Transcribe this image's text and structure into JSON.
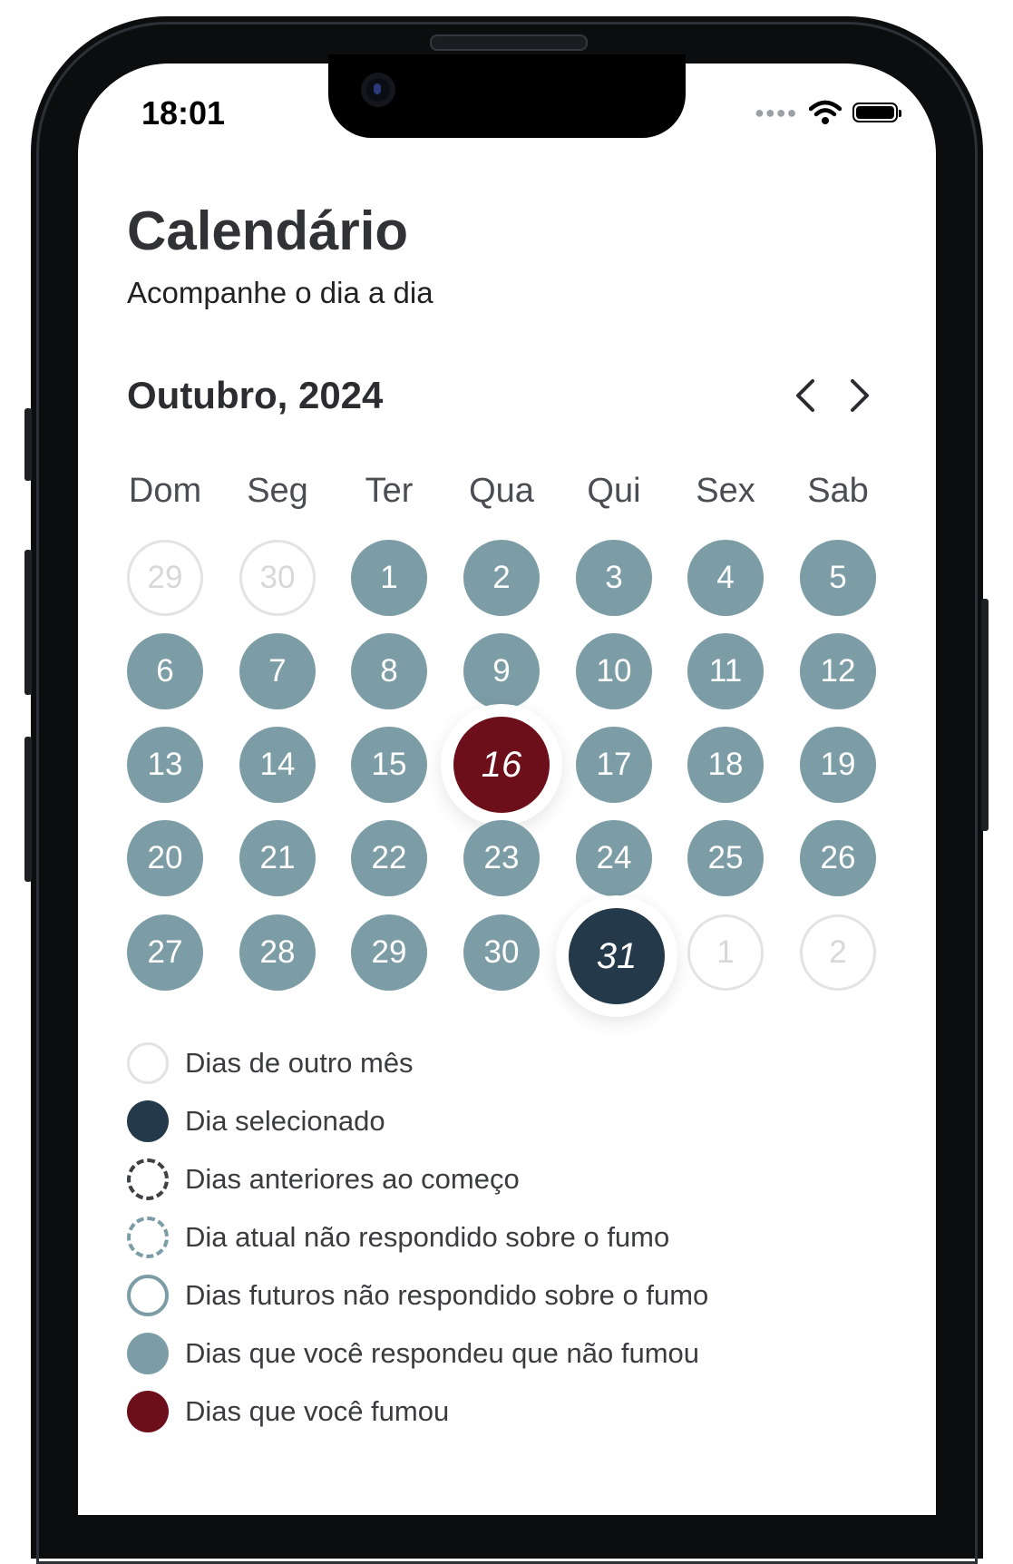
{
  "status_bar": {
    "time": "18:01"
  },
  "header": {
    "title": "Calendário",
    "subtitle": "Acompanhe o dia a dia"
  },
  "calendar": {
    "month_label": "Outubro, 2024",
    "weekdays": [
      "Dom",
      "Seg",
      "Ter",
      "Qua",
      "Qui",
      "Sex",
      "Sab"
    ],
    "weeks": [
      [
        {
          "n": "29",
          "s": "other"
        },
        {
          "n": "30",
          "s": "other"
        },
        {
          "n": "1",
          "s": "done"
        },
        {
          "n": "2",
          "s": "done"
        },
        {
          "n": "3",
          "s": "done"
        },
        {
          "n": "4",
          "s": "done"
        },
        {
          "n": "5",
          "s": "done"
        }
      ],
      [
        {
          "n": "6",
          "s": "done"
        },
        {
          "n": "7",
          "s": "done"
        },
        {
          "n": "8",
          "s": "done"
        },
        {
          "n": "9",
          "s": "done"
        },
        {
          "n": "10",
          "s": "done"
        },
        {
          "n": "11",
          "s": "done"
        },
        {
          "n": "12",
          "s": "done"
        }
      ],
      [
        {
          "n": "13",
          "s": "done"
        },
        {
          "n": "14",
          "s": "done"
        },
        {
          "n": "15",
          "s": "done"
        },
        {
          "n": "16",
          "s": "smoked"
        },
        {
          "n": "17",
          "s": "done"
        },
        {
          "n": "18",
          "s": "done"
        },
        {
          "n": "19",
          "s": "done"
        }
      ],
      [
        {
          "n": "20",
          "s": "done"
        },
        {
          "n": "21",
          "s": "done"
        },
        {
          "n": "22",
          "s": "done"
        },
        {
          "n": "23",
          "s": "done"
        },
        {
          "n": "24",
          "s": "done"
        },
        {
          "n": "25",
          "s": "done"
        },
        {
          "n": "26",
          "s": "done"
        }
      ],
      [
        {
          "n": "27",
          "s": "done"
        },
        {
          "n": "28",
          "s": "done"
        },
        {
          "n": "29",
          "s": "done"
        },
        {
          "n": "30",
          "s": "done"
        },
        {
          "n": "31",
          "s": "selected"
        },
        {
          "n": "1",
          "s": "other"
        },
        {
          "n": "2",
          "s": "other"
        }
      ]
    ]
  },
  "legend": [
    {
      "key": "other",
      "label": "Dias de outro mês"
    },
    {
      "key": "selected",
      "label": "Dia selecionado"
    },
    {
      "key": "before",
      "label": "Dias anteriores ao começo"
    },
    {
      "key": "today",
      "label": "Dia atual não respondido sobre o fumo"
    },
    {
      "key": "future",
      "label": "Dias futuros não respondido sobre o fumo"
    },
    {
      "key": "done",
      "label": "Dias que você respondeu que não fumou"
    },
    {
      "key": "smoked",
      "label": "Dias que você fumou"
    }
  ],
  "colors": {
    "answered_no_smoke": "#7d9da6",
    "smoked": "#6c0f1a",
    "selected": "#243a4b",
    "other_month_border": "#e3e3e3"
  }
}
